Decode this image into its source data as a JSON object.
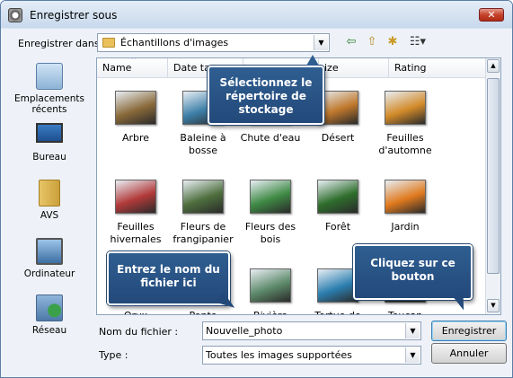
{
  "window": {
    "title": "Enregistrer sous",
    "close_label": "✕"
  },
  "location": {
    "label": "Enregistrer dans :",
    "value": "Échantillons d'images"
  },
  "toolbar": {
    "back": "⇦",
    "up": "⇧",
    "new_folder": "✱",
    "views": "☷▾"
  },
  "places": [
    {
      "label": "Emplacements récents",
      "icon": "recent-places-icon"
    },
    {
      "label": "Bureau",
      "icon": "desktop-icon"
    },
    {
      "label": "AVS",
      "icon": "user-folder-icon"
    },
    {
      "label": "Ordinateur",
      "icon": "computer-icon"
    },
    {
      "label": "Réseau",
      "icon": "network-icon"
    }
  ],
  "columns": [
    "Name",
    "Date ta",
    "",
    "ize",
    "Rating"
  ],
  "items": [
    {
      "label": "Arbre",
      "color": "#8a6a3a"
    },
    {
      "label": "Baleine à bosse",
      "color": "#3d7fa8"
    },
    {
      "label": "Chute d'eau",
      "color": "#4f7a3c"
    },
    {
      "label": "Désert",
      "color": "#c0782c"
    },
    {
      "label": "Feuilles d'automne",
      "color": "#d38b2a"
    },
    {
      "label": "Feuilles hivernales",
      "color": "#b23a3a"
    },
    {
      "label": "Fleurs de frangipanier",
      "color": "#4e6f3e"
    },
    {
      "label": "Fleurs des bois",
      "color": "#3f8a45"
    },
    {
      "label": "Forêt",
      "color": "#2f6e2d"
    },
    {
      "label": "Jardin",
      "color": "#e07a1e"
    },
    {
      "label": "Oryx",
      "color": "#c9a66b"
    },
    {
      "label": "Ponto",
      "color": "#7a8c9a"
    },
    {
      "label": "Rivière",
      "color": "#5d8a6a"
    },
    {
      "label": "Tortue de",
      "color": "#2c7fb0"
    },
    {
      "label": "Toucan",
      "color": "#333333"
    }
  ],
  "filename": {
    "label": "Nom du fichier :",
    "value": "Nouvelle_photo"
  },
  "filetype": {
    "label": "Type :",
    "value": "Toutes les images supportées"
  },
  "buttons": {
    "save": "Enregistrer",
    "cancel": "Annuler"
  },
  "callouts": {
    "folder": "Sélectionnez le répertoire de stockage",
    "filename": "Entrez le nom du fichier ici",
    "save": "Cliquez sur ce bouton"
  }
}
